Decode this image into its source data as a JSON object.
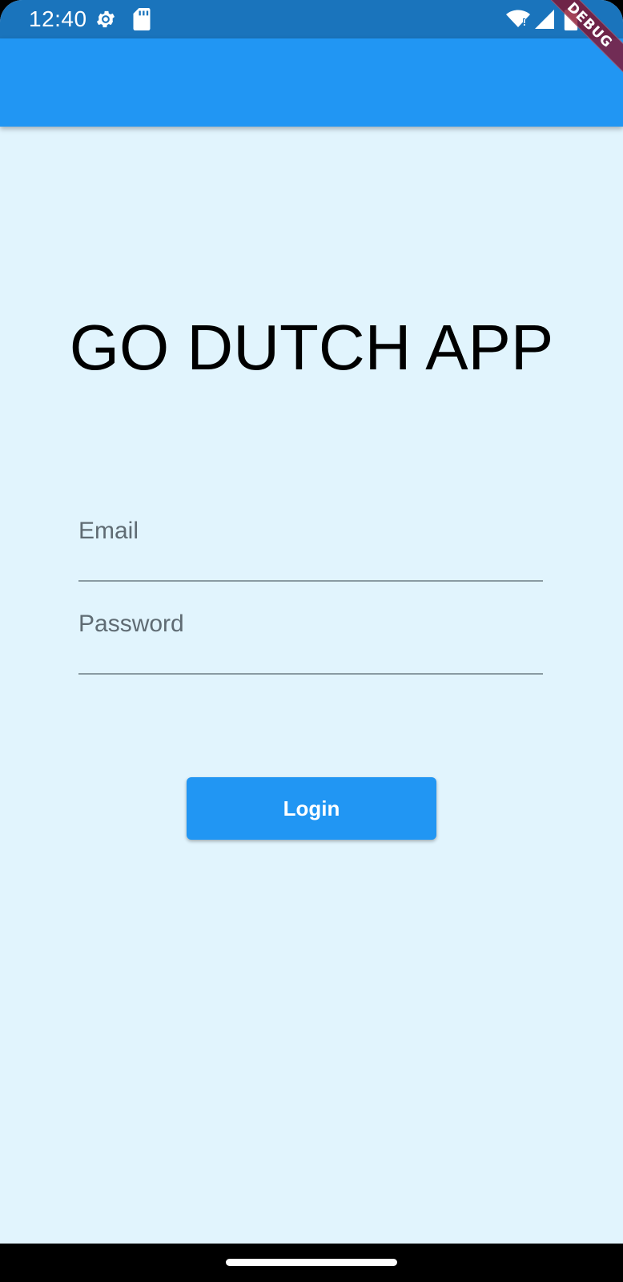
{
  "status_bar": {
    "time": "12:40",
    "icons": [
      "gear-icon",
      "sd-card-icon",
      "wifi-icon",
      "signal-icon",
      "battery-icon"
    ]
  },
  "debug_banner": {
    "label": "DEBUG"
  },
  "colors": {
    "app_bar": "#2196F3",
    "status_bar": "#1A74BC",
    "background": "#E1F4FD",
    "button": "#2196F3"
  },
  "main": {
    "title": "GO DUTCH APP",
    "email": {
      "label": "Email",
      "value": ""
    },
    "password": {
      "label": "Password",
      "value": ""
    },
    "login_label": "Login"
  }
}
